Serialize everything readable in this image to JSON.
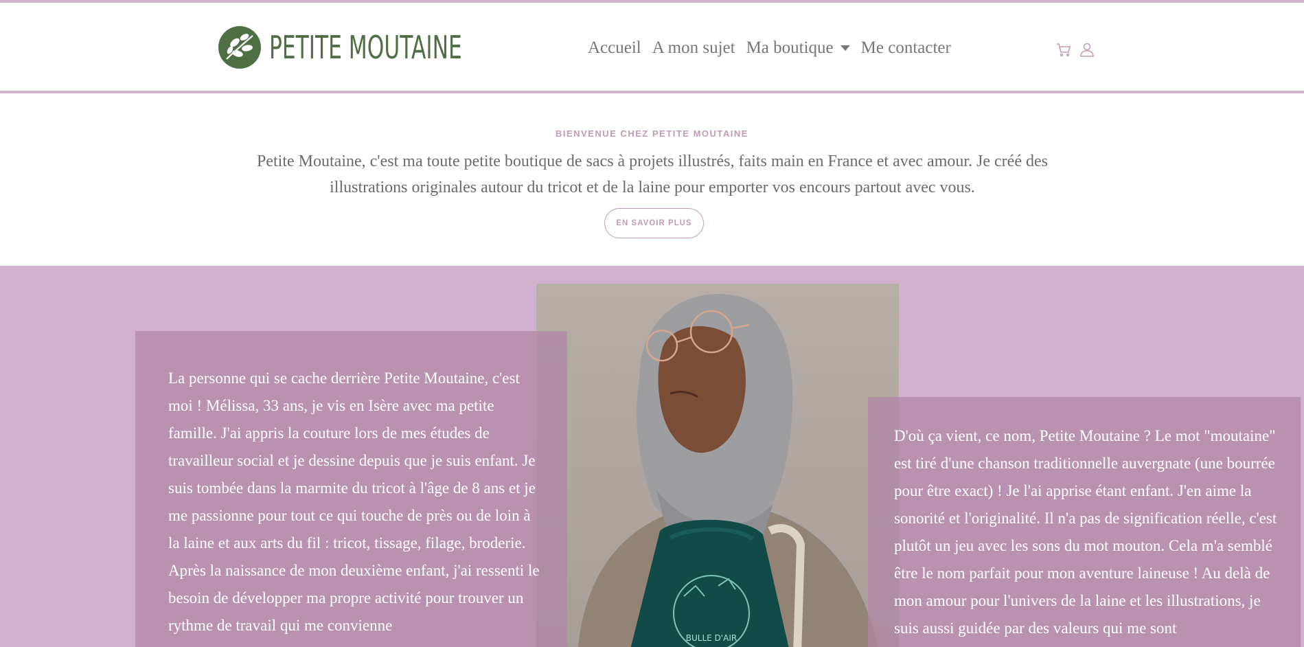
{
  "brand": {
    "name": "PETITE MOUTAINE",
    "color": "#4e6e43"
  },
  "accent_color": "#d0b3cc",
  "nav": {
    "items": [
      {
        "label": "Accueil"
      },
      {
        "label": "A mon sujet"
      },
      {
        "label": "Ma boutique",
        "has_dropdown": true
      },
      {
        "label": "Me contacter"
      }
    ]
  },
  "header_icons": [
    "cart-icon",
    "user-icon"
  ],
  "intro": {
    "kicker": "BIENVENUE CHEZ PETITE MOUTAINE",
    "text": "Petite Moutaine, c'est ma toute petite boutique de sacs à projets illustrés, faits main en France et avec amour. Je créé des illustrations originales autour du tricot et de la laine pour emporter vos encours partout avec vous.",
    "button_label": "EN SAVOIR PLUS"
  },
  "about": {
    "left_text": "La personne qui se cache derrière Petite Moutaine, c'est moi ! Mélissa, 33 ans, je vis en Isère avec ma petite famille. J'ai appris la couture lors de mes études de travailleur social et je dessine depuis que je suis enfant. Je suis tombée dans la marmite du tricot à l'âge de 8 ans et je me passionne pour tout ce qui touche de près ou de loin à la laine et aux arts du fil : tricot, tissage, filage, broderie. Après la naissance de mon deuxième enfant, j'ai ressenti le besoin de développer ma propre activité pour trouver un rythme de travail qui me convienne",
    "right_text": "D'où ça vient, ce nom, Petite Moutaine ? Le mot \"moutaine\" est tiré d'une chanson traditionnelle auvergnate (une bourrée pour être exact) ! Je l'ai apprise étant enfant. J'en aime la sonorité et l'originalité. Il n'a pas de signification réelle, c'est plutôt un jeu avec les sons du mot mouton. Cela m'a semblé être le nom parfait pour mon aventure laineuse ! Au delà de mon amour pour l'univers de la laine et les illustrations, je suis aussi guidée par des valeurs qui me sont",
    "photo_bag_text": "BULLE D'AIR",
    "background_color": "#d0b0cc"
  }
}
